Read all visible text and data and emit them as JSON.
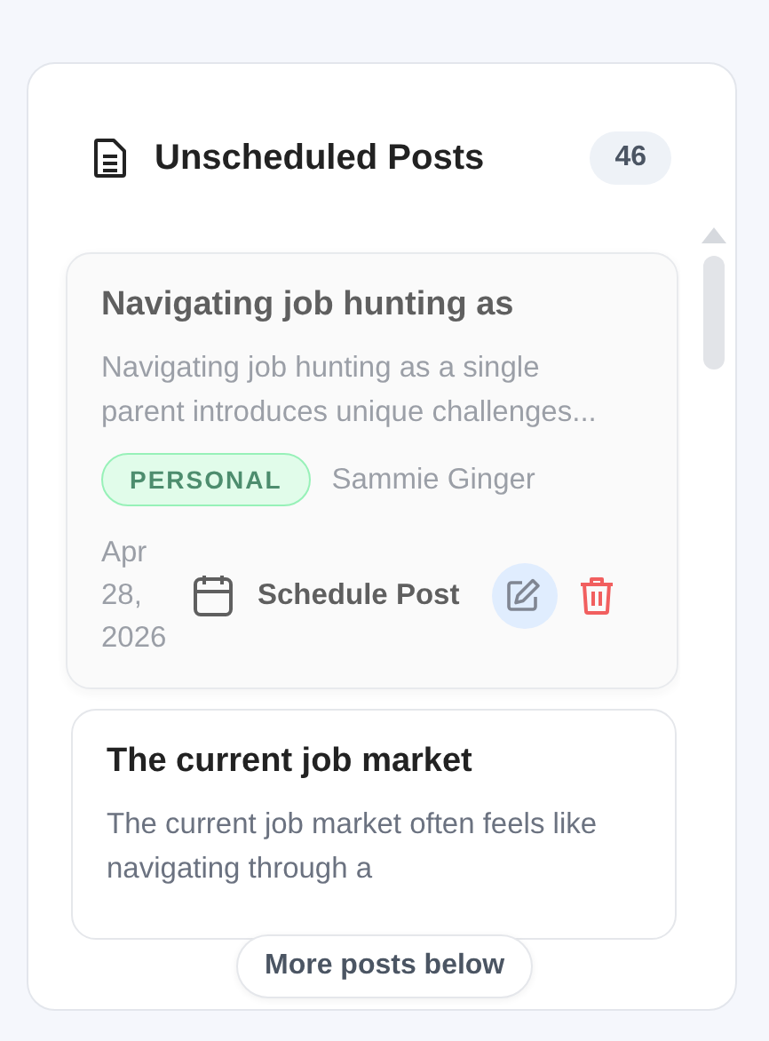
{
  "panel": {
    "title": "Unscheduled Posts",
    "count": "46"
  },
  "posts": [
    {
      "title": "Navigating job hunting as",
      "excerpt": "Navigating job hunting as a single parent introduces unique challenges...",
      "tag": "PERSONAL",
      "author": "Sammie Ginger",
      "date": "Apr 28, 2026",
      "schedule_label": "Schedule Post",
      "dimmed": true
    },
    {
      "title": "The current job market",
      "excerpt": "The current job market often feels like navigating through a",
      "dimmed": false
    }
  ],
  "more_button": "More posts below"
}
